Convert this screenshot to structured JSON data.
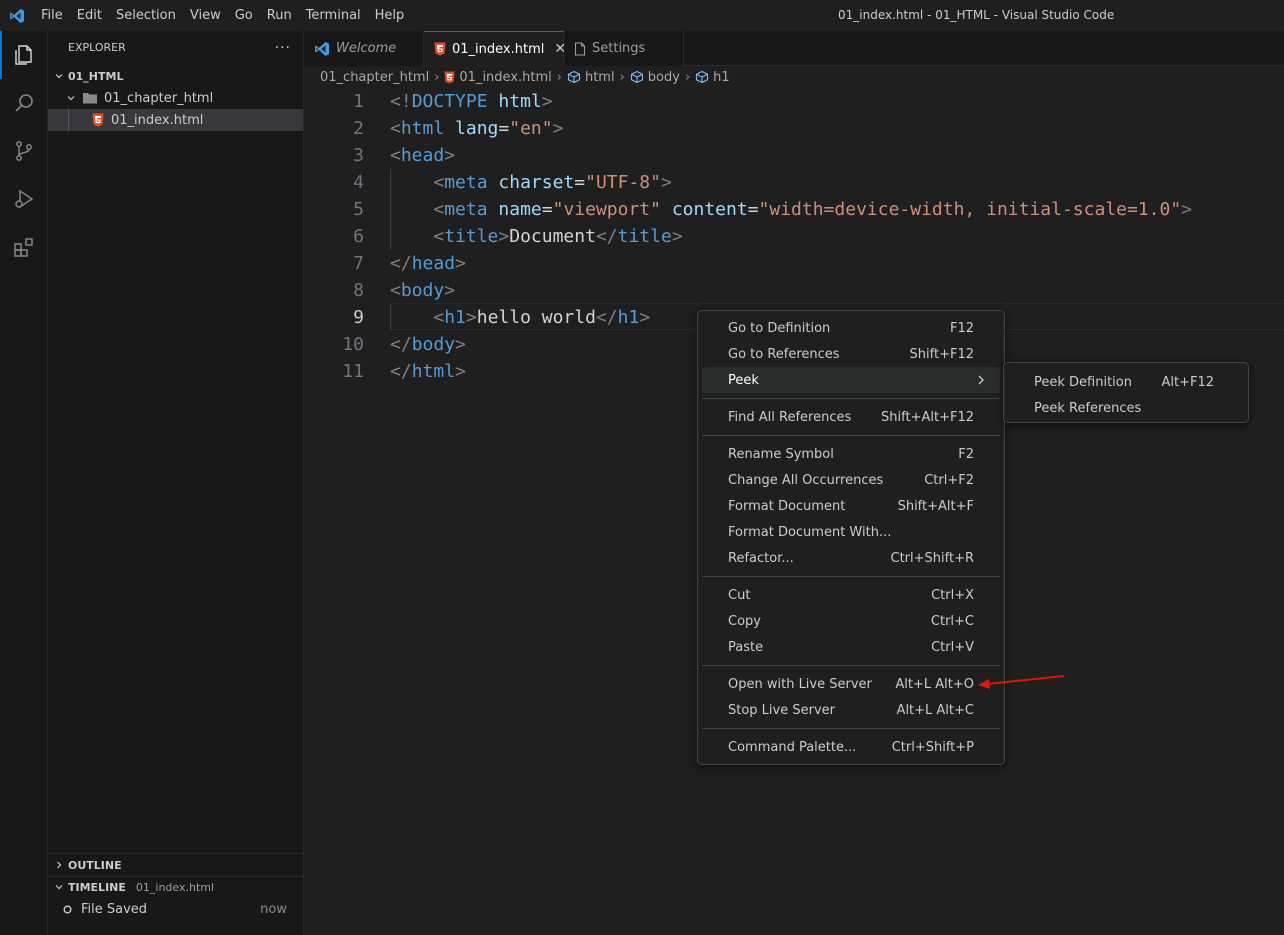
{
  "titlebar": {
    "menu": [
      "File",
      "Edit",
      "Selection",
      "View",
      "Go",
      "Run",
      "Terminal",
      "Help"
    ],
    "window_title": "01_index.html - 01_HTML - Visual Studio Code"
  },
  "activity_bar": [
    "explorer-icon",
    "search-icon",
    "source-control-icon",
    "run-debug-icon",
    "extensions-icon"
  ],
  "sidebar": {
    "title": "EXPLORER",
    "more": "···",
    "root": "01_HTML",
    "folder": "01_chapter_html",
    "file": "01_index.html",
    "outline": "OUTLINE",
    "timeline": "TIMELINE",
    "timeline_file": "01_index.html",
    "timeline_event": "File Saved",
    "timeline_time": "now"
  },
  "tabs": [
    {
      "label": "Welcome",
      "icon": "vscode-icon",
      "active": false
    },
    {
      "label": "01_index.html",
      "icon": "html5-icon",
      "active": true,
      "close": "✕"
    },
    {
      "label": "Settings",
      "icon": "file-icon",
      "active": false
    }
  ],
  "breadcrumb": [
    "01_chapter_html",
    "01_index.html",
    "html",
    "body",
    "h1"
  ],
  "editor": {
    "current_line": 9,
    "line_numbers": [
      "1",
      "2",
      "3",
      "4",
      "5",
      "6",
      "7",
      "8",
      "9",
      "10",
      "11"
    ]
  },
  "context_menu": {
    "groups": [
      [
        {
          "label": "Go to Definition",
          "shortcut": "F12"
        },
        {
          "label": "Go to References",
          "shortcut": "Shift+F12"
        },
        {
          "label": "Peek",
          "shortcut": "",
          "submenu": true
        }
      ],
      [
        {
          "label": "Find All References",
          "shortcut": "Shift+Alt+F12"
        }
      ],
      [
        {
          "label": "Rename Symbol",
          "shortcut": "F2"
        },
        {
          "label": "Change All Occurrences",
          "shortcut": "Ctrl+F2"
        },
        {
          "label": "Format Document",
          "shortcut": "Shift+Alt+F"
        },
        {
          "label": "Format Document With...",
          "shortcut": ""
        },
        {
          "label": "Refactor...",
          "shortcut": "Ctrl+Shift+R"
        }
      ],
      [
        {
          "label": "Cut",
          "shortcut": "Ctrl+X"
        },
        {
          "label": "Copy",
          "shortcut": "Ctrl+C"
        },
        {
          "label": "Paste",
          "shortcut": "Ctrl+V"
        }
      ],
      [
        {
          "label": "Open with Live Server",
          "shortcut": "Alt+L Alt+O"
        },
        {
          "label": "Stop Live Server",
          "shortcut": "Alt+L Alt+C"
        }
      ],
      [
        {
          "label": "Command Palette...",
          "shortcut": "Ctrl+Shift+P"
        }
      ]
    ]
  },
  "peek_submenu": [
    {
      "label": "Peek Definition",
      "shortcut": "Alt+F12"
    },
    {
      "label": "Peek References",
      "shortcut": ""
    }
  ],
  "annotation": {
    "arrow_color": "#e51400"
  }
}
